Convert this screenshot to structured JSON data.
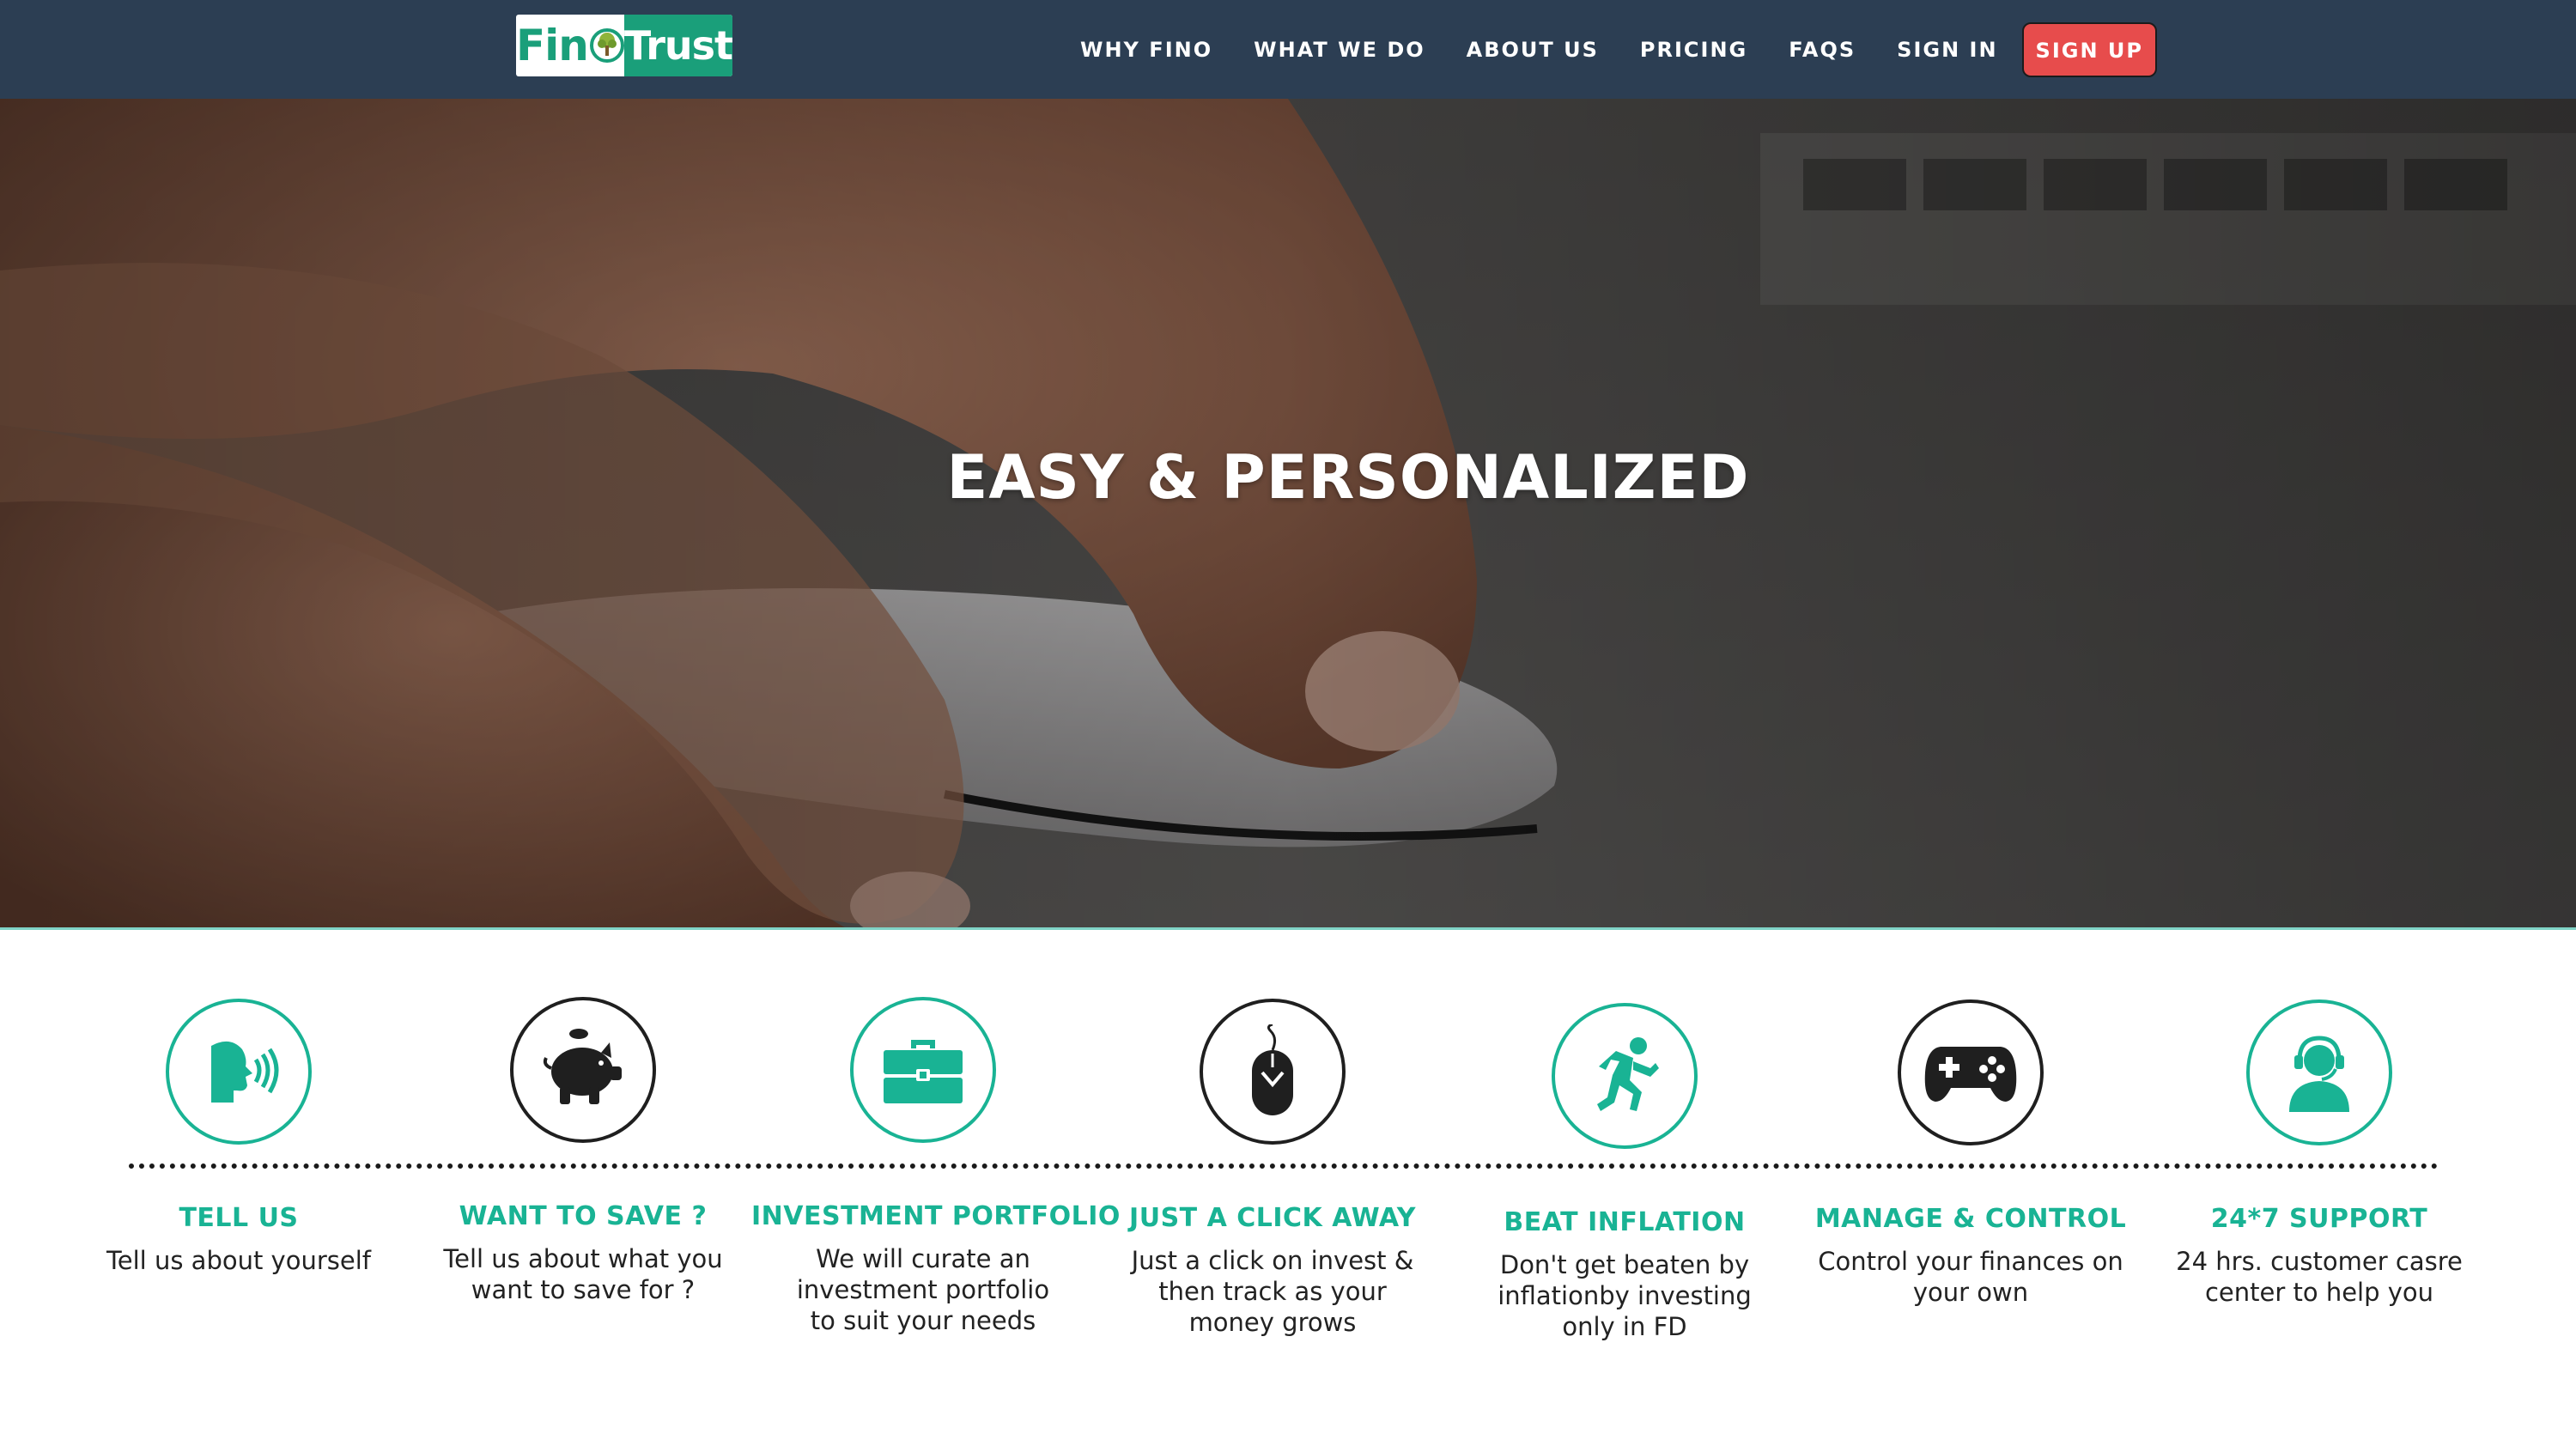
{
  "brand": {
    "logo_part1": "Fin",
    "logo_part2": "Trust",
    "accent_color": "#19b394",
    "nav_bg_color": "#2c3e53",
    "signup_color": "#e74c4c"
  },
  "nav": {
    "items": [
      {
        "label": "WHY FINO"
      },
      {
        "label": "WHAT WE DO"
      },
      {
        "label": "ABOUT US"
      },
      {
        "label": "PRICING"
      },
      {
        "label": "FAQS"
      },
      {
        "label": "SIGN IN"
      }
    ],
    "signup_label": "SIGN UP"
  },
  "hero": {
    "title": "EASY & PERSONALIZED"
  },
  "features": [
    {
      "title": "TELL US",
      "desc": "Tell us about yourself",
      "icon": "speaking-head-icon"
    },
    {
      "title": "WANT TO SAVE ?",
      "desc": "Tell us about what you\nwant to save for ?",
      "icon": "piggy-bank-icon"
    },
    {
      "title": "INVESTMENT PORTFOLIO",
      "desc": "We will curate an\ninvestment portfolio\nto suit your needs",
      "icon": "briefcase-icon"
    },
    {
      "title": "JUST A CLICK AWAY",
      "desc": "Just a click on invest &\nthen track as your\nmoney grows",
      "icon": "mouse-icon"
    },
    {
      "title": "BEAT INFLATION",
      "desc": "Don't get beaten by\ninflationby investing\nonly in FD",
      "icon": "runner-icon"
    },
    {
      "title": "MANAGE & CONTROL",
      "desc": "Control your finances on\nyour  own",
      "icon": "gamepad-icon"
    },
    {
      "title": "24*7 SUPPORT",
      "desc": "24 hrs. customer casre\ncenter to help you",
      "icon": "support-agent-icon"
    }
  ]
}
